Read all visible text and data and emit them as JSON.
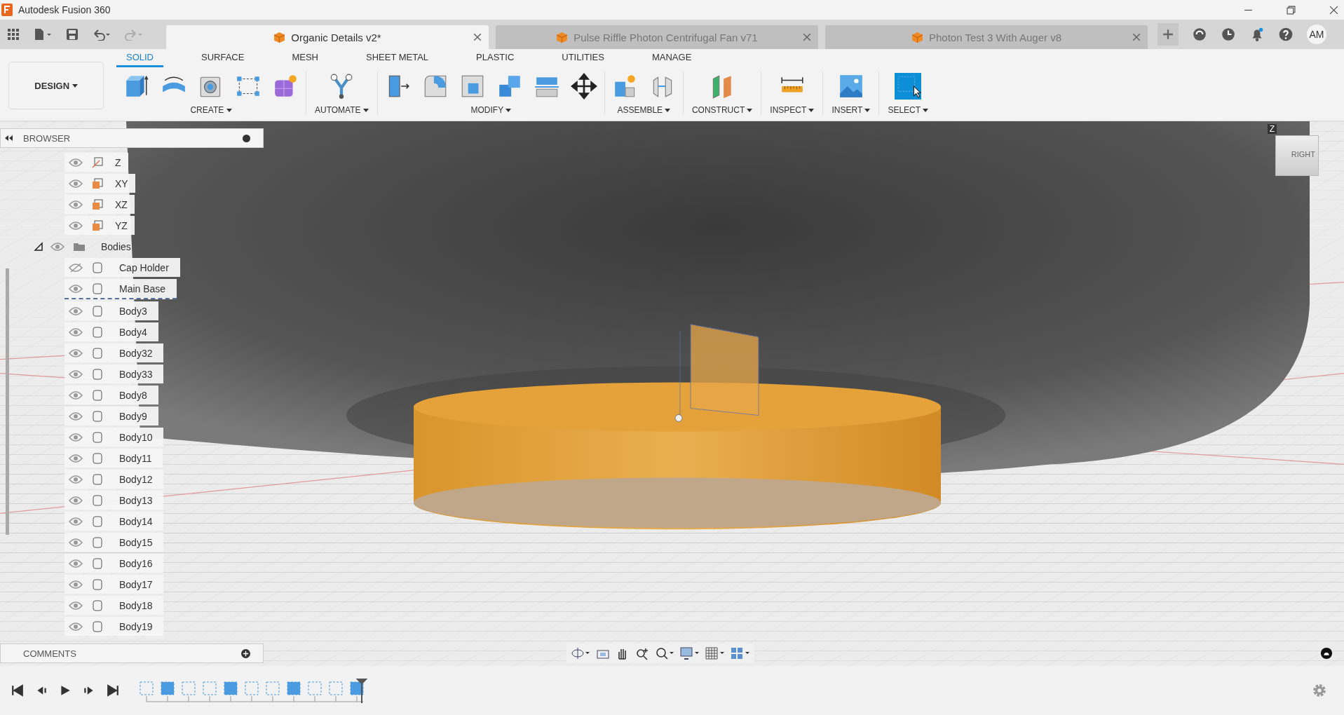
{
  "window": {
    "title": "Autodesk Fusion 360"
  },
  "doc_tabs": [
    {
      "label": "Organic Details v2*",
      "selected": true
    },
    {
      "label": "Pulse Riffle Photon Centrifugal Fan v71",
      "selected": false
    },
    {
      "label": "Photon Test 3 With Auger v8",
      "selected": false
    }
  ],
  "user": {
    "initials": "AM"
  },
  "workspace": {
    "label": "DESIGN"
  },
  "ribbon_tabs": [
    {
      "label": "SOLID",
      "selected": true
    },
    {
      "label": "SURFACE",
      "selected": false
    },
    {
      "label": "MESH",
      "selected": false
    },
    {
      "label": "SHEET METAL",
      "selected": false
    },
    {
      "label": "PLASTIC",
      "selected": false
    },
    {
      "label": "UTILITIES",
      "selected": false
    },
    {
      "label": "MANAGE",
      "selected": false
    }
  ],
  "tool_groups": [
    {
      "label": "CREATE",
      "kind": "create"
    },
    {
      "label": "AUTOMATE",
      "kind": "automate"
    },
    {
      "label": "MODIFY",
      "kind": "modify"
    },
    {
      "label": "ASSEMBLE",
      "kind": "assemble"
    },
    {
      "label": "CONSTRUCT",
      "kind": "construct"
    },
    {
      "label": "INSPECT",
      "kind": "inspect"
    },
    {
      "label": "INSERT",
      "kind": "insert"
    },
    {
      "label": "SELECT",
      "kind": "select"
    }
  ],
  "browser": {
    "title": "BROWSER",
    "items": [
      {
        "label": "Z",
        "kind": "axis",
        "visible": true
      },
      {
        "label": "XY",
        "kind": "plane",
        "visible": true
      },
      {
        "label": "XZ",
        "kind": "plane",
        "visible": true
      },
      {
        "label": "YZ",
        "kind": "plane",
        "visible": true
      },
      {
        "label": "Bodies",
        "kind": "folder",
        "visible": true,
        "expanded": true,
        "children": [
          {
            "label": "Cap Holder",
            "kind": "body",
            "visible": false,
            "active": false
          },
          {
            "label": "Main Base",
            "kind": "body",
            "visible": true,
            "active": true
          },
          {
            "label": "Body3",
            "kind": "body",
            "visible": true,
            "active": false
          },
          {
            "label": "Body4",
            "kind": "body",
            "visible": true,
            "active": false
          },
          {
            "label": "Body32",
            "kind": "body",
            "visible": true,
            "active": false
          },
          {
            "label": "Body33",
            "kind": "body",
            "visible": true,
            "active": false
          },
          {
            "label": "Body8",
            "kind": "body",
            "visible": true,
            "active": false
          },
          {
            "label": "Body9",
            "kind": "body",
            "visible": true,
            "active": false
          },
          {
            "label": "Body10",
            "kind": "body",
            "visible": true,
            "active": false
          },
          {
            "label": "Body11",
            "kind": "body",
            "visible": true,
            "active": false
          },
          {
            "label": "Body12",
            "kind": "body",
            "visible": true,
            "active": false
          },
          {
            "label": "Body13",
            "kind": "body",
            "visible": true,
            "active": false
          },
          {
            "label": "Body14",
            "kind": "body",
            "visible": true,
            "active": false
          },
          {
            "label": "Body15",
            "kind": "body",
            "visible": true,
            "active": false
          },
          {
            "label": "Body16",
            "kind": "body",
            "visible": true,
            "active": false
          },
          {
            "label": "Body17",
            "kind": "body",
            "visible": true,
            "active": false
          },
          {
            "label": "Body18",
            "kind": "body",
            "visible": true,
            "active": false
          },
          {
            "label": "Body19",
            "kind": "body",
            "visible": true,
            "active": false
          }
        ]
      }
    ]
  },
  "view_cube": {
    "face": "RIGHT",
    "axis": "Z"
  },
  "comments": {
    "title": "COMMENTS"
  }
}
